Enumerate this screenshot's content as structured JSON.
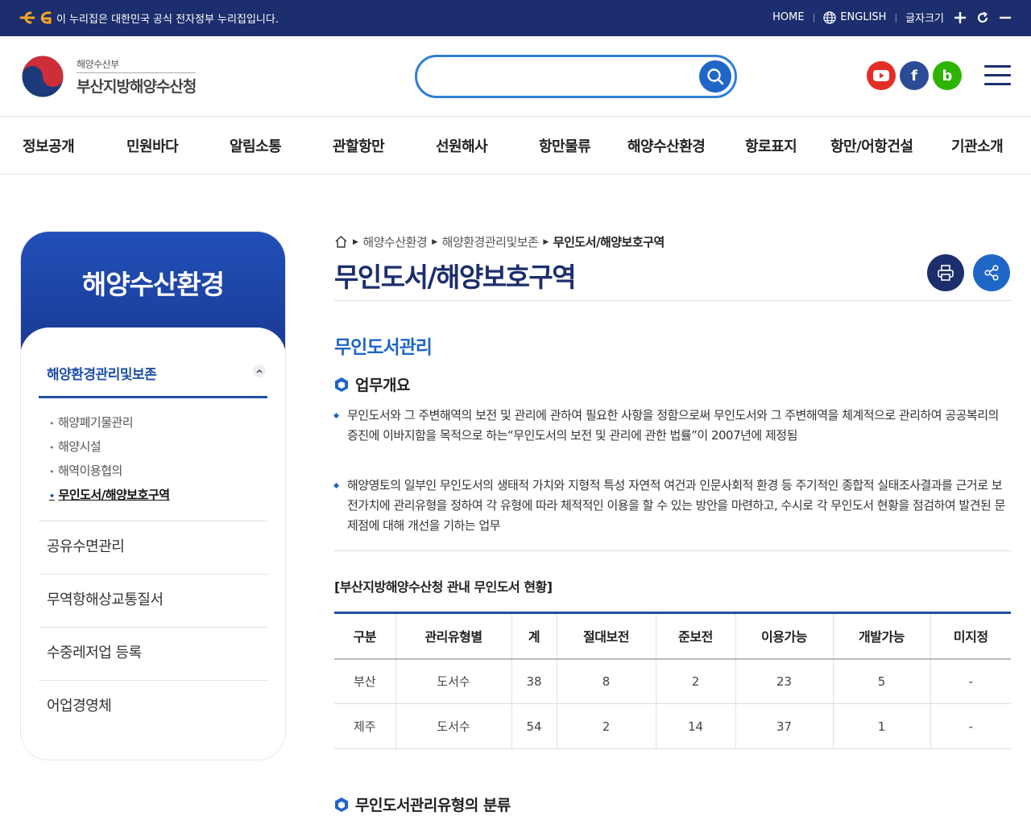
{
  "gov_banner": {
    "notice": "이 누리집은 대한민국 공식 전자정부 누리집입니다.",
    "home": "HOME",
    "english": "ENGLISH",
    "font_size": "글자크기"
  },
  "header": {
    "ministry": "해양수산부",
    "agency": "부산지방해양수산청",
    "search_placeholder": "",
    "sns": [
      {
        "name": "youtube",
        "color": "#e52d27"
      },
      {
        "name": "facebook",
        "color": "#2b4b96",
        "glyph": "f"
      },
      {
        "name": "blog",
        "color": "#2db400",
        "glyph": "b"
      }
    ]
  },
  "gnb": [
    "정보공개",
    "민원바다",
    "알림소통",
    "관할항만",
    "선원해사",
    "항만물류",
    "해양수산환경",
    "항로표지",
    "항만/어항건설",
    "기관소개"
  ],
  "lnb": {
    "title": "해양수산환경",
    "active_group": "해양환경관리및보존",
    "sub_items": [
      "해양폐기물관리",
      "해양시설",
      "해역이용협의",
      "무인도서/해양보호구역"
    ],
    "current_sub": "무인도서/해양보호구역",
    "other_groups": [
      "공유수면관리",
      "무역항해상교통질서",
      "수중레저업 등록",
      "어업경영체"
    ]
  },
  "content": {
    "breadcrumb": [
      "해양수산환경",
      "해양환경관리및보존",
      "무인도서/해양보호구역"
    ],
    "page_title": "무인도서/해양보호구역",
    "section_title": "무인도서관리",
    "subsection_1": "업무개요",
    "para_1": "무인도서와 그 주변해역의 보전 및 관리에 관하여 필요한 사항을 정함으로써 무인도서와 그 주변해역을 체계적으로 관리하여 공공복리의 증진에 이바지함을 목적으로 하는“무인도서의 보전 및 관리에 관한 법률”이 2007년에 제정됨",
    "para_2": "해양영토의 일부인 무인도서의 생태적 가치와 지형적 특성 자연적 여건과 인문사회적 환경 등 주기적인 종합적 실태조사결과를 근거로 보전가치에 관리유형을 정하여 각 유형에 따라 체적적인 이용을 할 수 있는 방안을 마련하고, 수시로 각 무인도서 현황을 점검하여 발견된 문제점에 대해 개선을 기하는 업무",
    "table_caption": "[부산지방해양수산청 관내 무인도서 현황]",
    "table": {
      "headers": [
        "구분",
        "관리유형별",
        "계",
        "절대보전",
        "준보전",
        "이용가능",
        "개발가능",
        "미지정"
      ],
      "rows": [
        [
          "부산",
          "도서수",
          "38",
          "8",
          "2",
          "23",
          "5",
          "-"
        ],
        [
          "제주",
          "도서수",
          "54",
          "2",
          "14",
          "37",
          "1",
          "-"
        ]
      ]
    },
    "subsection_2": "무인도서관리유형의 분류"
  },
  "colors": {
    "navy": "#1c2e6d",
    "accent_blue": "#1f66c7",
    "table_top": "#1f4fa8"
  }
}
